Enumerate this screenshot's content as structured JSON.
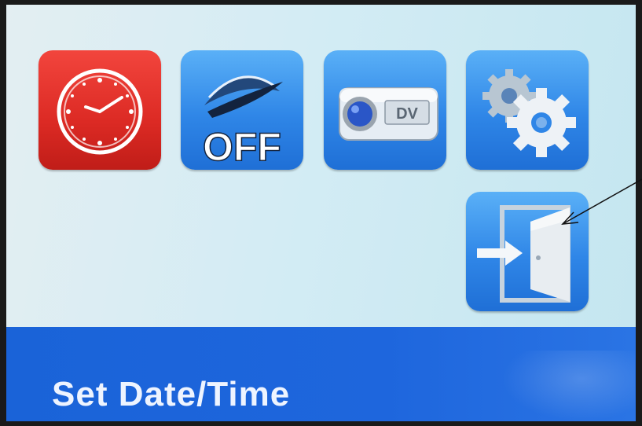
{
  "menu": {
    "items": [
      {
        "id": "date-time",
        "icon": "clock-icon",
        "color": "#dc2a24",
        "selected": true
      },
      {
        "id": "auto-off",
        "icon": "power-off-icon",
        "badge": "OFF",
        "color": "#2f86e7"
      },
      {
        "id": "video-mode",
        "icon": "camcorder-icon",
        "badge": "DV",
        "color": "#2f86e7"
      },
      {
        "id": "settings",
        "icon": "gears-icon",
        "color": "#2f86e7"
      },
      {
        "id": "exit",
        "icon": "exit-door-icon",
        "color": "#2f86e7"
      }
    ]
  },
  "footer": {
    "label": "Set Date/Time"
  },
  "colors": {
    "footer_bg": "#1e66dd",
    "selected_bg": "#dc2a24",
    "tile_bg": "#2f86e7",
    "screen_bg": "#d3ecf4"
  }
}
